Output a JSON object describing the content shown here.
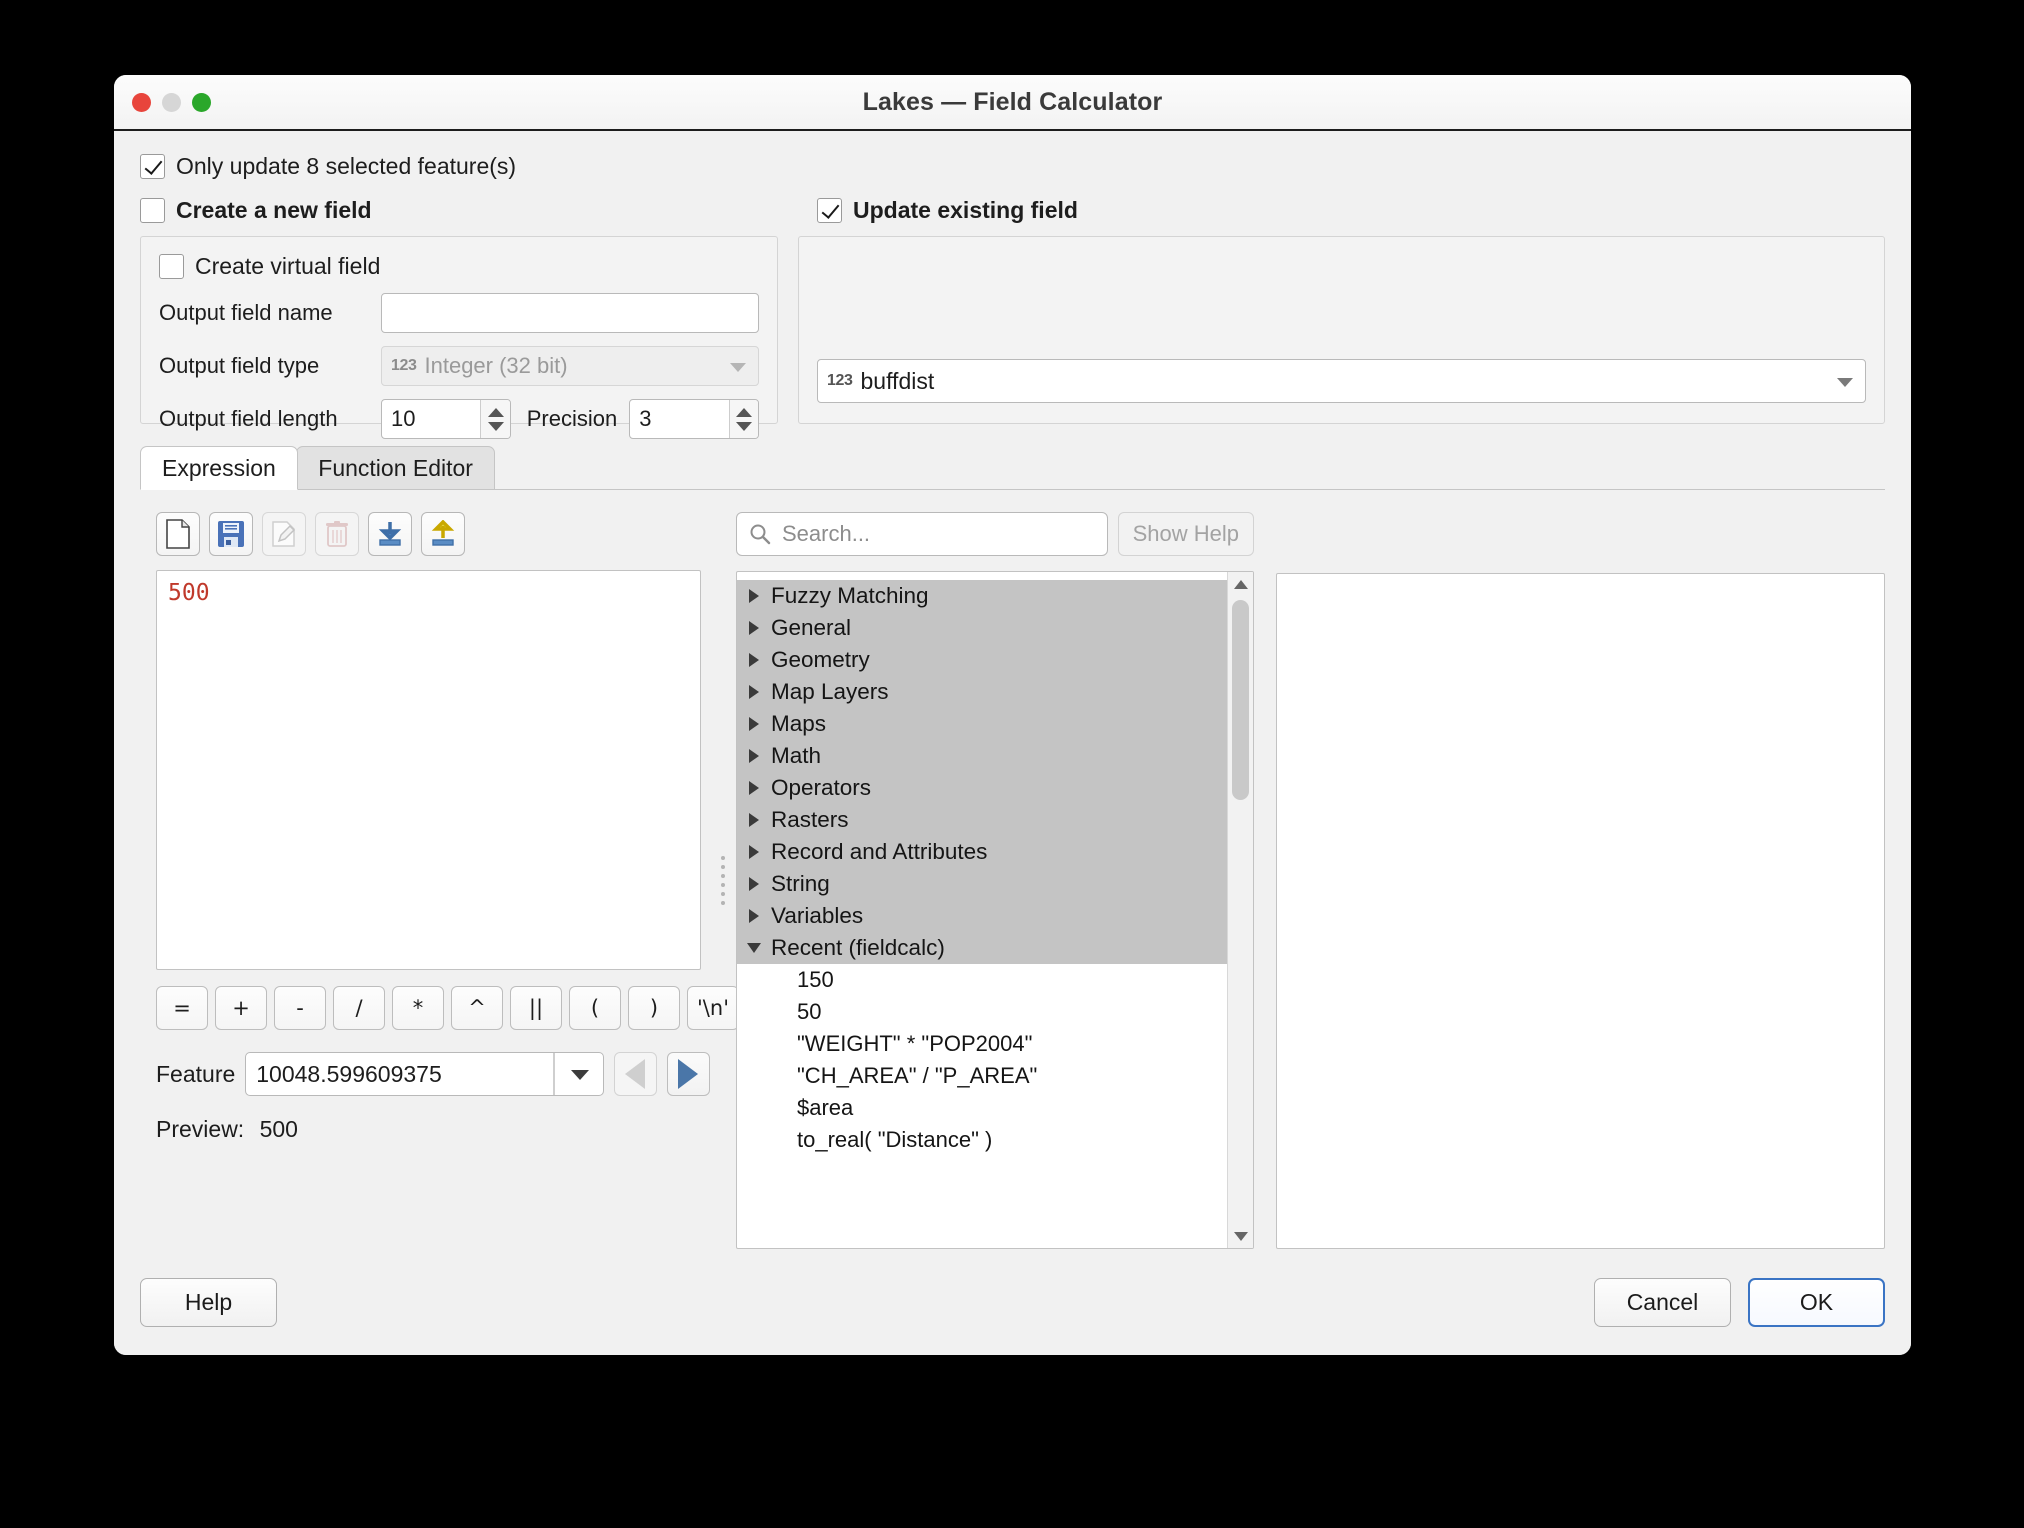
{
  "window": {
    "title": "Lakes — Field Calculator",
    "traffic": {
      "close": "close-button",
      "minimize": "minimize-button",
      "zoom": "zoom-button"
    }
  },
  "top": {
    "only_update_selected": {
      "label": "Only update 8 selected feature(s)",
      "checked": true
    },
    "create_new_field": {
      "label": "Create a new field",
      "checked": false
    },
    "update_existing_field": {
      "label": "Update existing field",
      "checked": true
    }
  },
  "new_field": {
    "create_virtual_field": {
      "label": "Create virtual field",
      "checked": false
    },
    "output_field_name": {
      "label": "Output field name",
      "value": "",
      "placeholder": ""
    },
    "output_field_type": {
      "label": "Output field type",
      "value": "Integer (32 bit)",
      "badge": "123"
    },
    "output_field_length": {
      "label": "Output field length",
      "value": "10"
    },
    "precision": {
      "label": "Precision",
      "value": "3"
    }
  },
  "existing_field": {
    "selected": "buffdist",
    "badge": "123"
  },
  "tabs": [
    {
      "label": "Expression",
      "active": true
    },
    {
      "label": "Function Editor",
      "active": false
    }
  ],
  "toolbar": [
    {
      "name": "new-file-icon",
      "enabled": true
    },
    {
      "name": "save-icon",
      "enabled": true
    },
    {
      "name": "edit-icon",
      "enabled": false
    },
    {
      "name": "delete-icon",
      "enabled": false
    },
    {
      "name": "import-icon",
      "enabled": true
    },
    {
      "name": "export-icon",
      "enabled": true
    }
  ],
  "expression": {
    "text": "500"
  },
  "operators": [
    "=",
    "+",
    "-",
    "/",
    "*",
    "^",
    "||",
    "(",
    ")",
    "'\\n'"
  ],
  "feature": {
    "label": "Feature",
    "value": "10048.599609375",
    "prev_enabled": false,
    "next_enabled": true
  },
  "preview": {
    "label": "Preview:",
    "value": "500"
  },
  "search": {
    "placeholder": "Search...",
    "value": ""
  },
  "show_help": {
    "label": "Show Help",
    "enabled": false
  },
  "function_tree": [
    {
      "label": "Fuzzy Matching",
      "type": "group",
      "expanded": false
    },
    {
      "label": "General",
      "type": "group",
      "expanded": false
    },
    {
      "label": "Geometry",
      "type": "group",
      "expanded": false
    },
    {
      "label": "Map Layers",
      "type": "group",
      "expanded": false
    },
    {
      "label": "Maps",
      "type": "group",
      "expanded": false
    },
    {
      "label": "Math",
      "type": "group",
      "expanded": false
    },
    {
      "label": "Operators",
      "type": "group",
      "expanded": false
    },
    {
      "label": "Rasters",
      "type": "group",
      "expanded": false
    },
    {
      "label": "Record and Attributes",
      "type": "group",
      "expanded": false
    },
    {
      "label": "String",
      "type": "group",
      "expanded": false
    },
    {
      "label": "Variables",
      "type": "group",
      "expanded": false
    },
    {
      "label": "Recent (fieldcalc)",
      "type": "group",
      "expanded": true
    },
    {
      "label": "150",
      "type": "leaf"
    },
    {
      "label": "50",
      "type": "leaf"
    },
    {
      "label": "\"WEIGHT\"  *  \"POP2004\"",
      "type": "leaf"
    },
    {
      "label": "\"CH_AREA\"  /  \"P_AREA\"",
      "type": "leaf"
    },
    {
      "label": "$area",
      "type": "leaf"
    },
    {
      "label": "to_real(  \"Distance\" )",
      "type": "leaf"
    }
  ],
  "footer": {
    "help": "Help",
    "cancel": "Cancel",
    "ok": "OK"
  },
  "colors": {
    "accent": "#3a74c4",
    "expression_text": "#c0392b",
    "tree_selection": "#c4c4c4"
  }
}
